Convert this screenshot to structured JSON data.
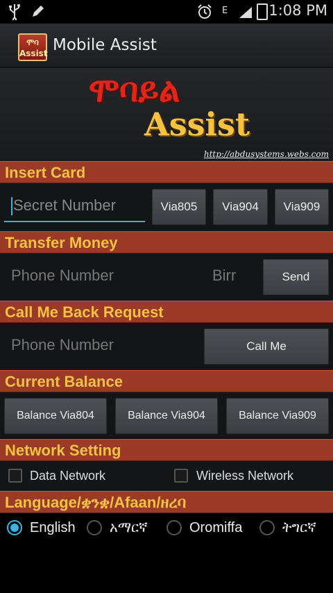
{
  "status": {
    "time": "1:08 PM",
    "network_type": "E"
  },
  "app": {
    "title": "Mobile Assist",
    "icon_text_top": "ሞባ",
    "icon_text_bottom": "Assist"
  },
  "banner": {
    "amharic": "ሞባይል",
    "assist": "Assist",
    "url": "http://abdusystems.webs.com"
  },
  "insert_card": {
    "header": "Insert Card",
    "secret_placeholder": "Secret Number",
    "via805": "Via805",
    "via904": "Via904",
    "via909": "Via909"
  },
  "transfer": {
    "header": "Transfer Money",
    "phone_placeholder": "Phone Number",
    "birr_placeholder": "Birr",
    "send": "Send"
  },
  "callback": {
    "header": "Call Me Back Request",
    "phone_placeholder": "Phone Number",
    "call_me": "Call Me"
  },
  "balance": {
    "header": "Current Balance",
    "via804": "Balance Via804",
    "via904": "Balance Via904",
    "via909": "Balance Via909"
  },
  "network": {
    "header": "Network Setting",
    "data": "Data Network",
    "wireless": "Wireless Network"
  },
  "language": {
    "header": "Language/ቋንቋ/Afaan/ዘረባ",
    "options": [
      "English",
      "አማርኛ",
      "Oromiffa",
      "ትግርኛ"
    ],
    "selected": "English"
  },
  "colors": {
    "accent": "#33b5e5",
    "section_bg": "#9b3a27",
    "section_text": "#f5c242"
  }
}
